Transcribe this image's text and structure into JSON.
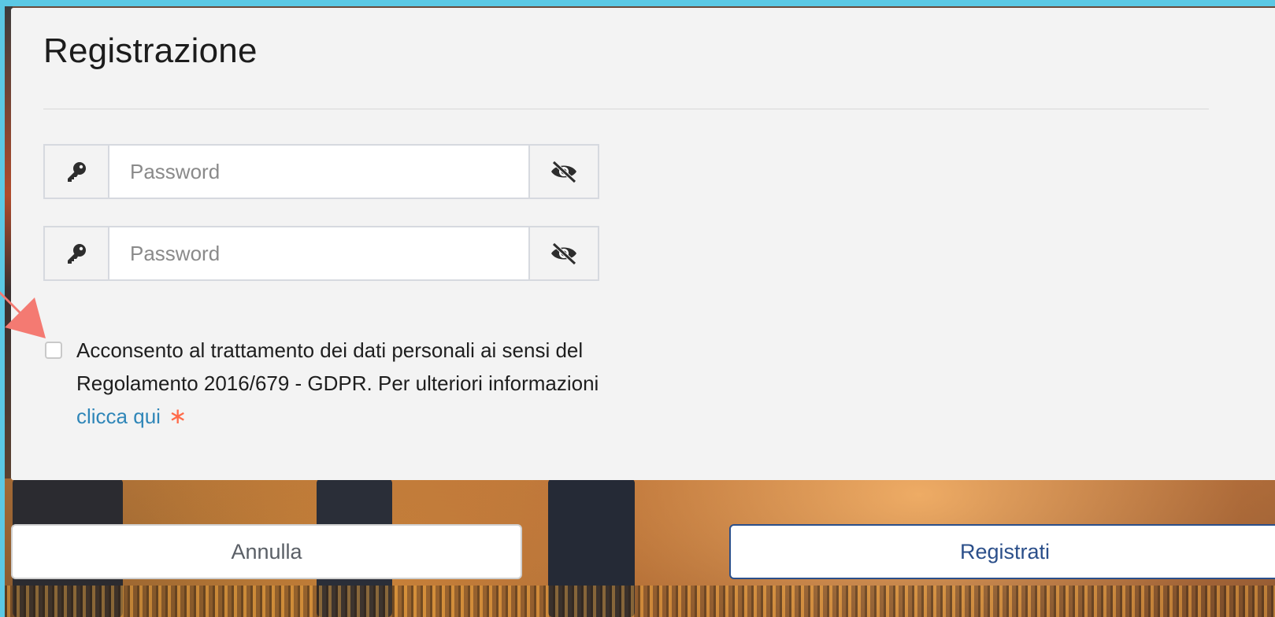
{
  "modal": {
    "title": "Registrazione"
  },
  "fields": [
    {
      "placeholder": "Password",
      "left_icon": "key-icon",
      "right_icon": "eye-slash-icon"
    },
    {
      "placeholder": "Password",
      "left_icon": "key-icon",
      "right_icon": "eye-slash-icon"
    }
  ],
  "consent": {
    "checked": false,
    "text_line": "Acconsento al trattamento dei dati personali ai sensi del Regolamento 2016/679 - GDPR. Per ulteriori informazioni",
    "link_label": "clicca qui",
    "required_mark": "∗"
  },
  "buttons": {
    "cancel_label": "Annulla",
    "register_label": "Registrati"
  },
  "colors": {
    "frame": "#5bc8e4",
    "link": "#2f86b8",
    "required": "#ff6b4a",
    "primary": "#2b4f8a",
    "annotation_arrow": "#f47a72"
  }
}
